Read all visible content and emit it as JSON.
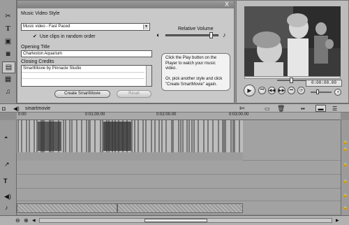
{
  "editor": {
    "close_label": "X",
    "music_video_style_label": "Music Video Style",
    "style_value": "Music video - Fast Paced",
    "random_order_label": "Use clips in random order",
    "relative_volume_label": "Relative Volume",
    "opening_title_label": "Opening Title",
    "opening_title_value": "Charleston Aquarium",
    "closing_credits_label": "Closing Credits",
    "closing_credits_value": "SmartMovie by Pinnacle Studio",
    "create_button": "Create SmartMovie",
    "reset_button": "Reset",
    "hint_text": "Click the Play button on the Player to watch your music video.\n\nOr, pick another style and click \"Create SmartMovie\" again."
  },
  "player": {
    "timecode": "0:00:00.00"
  },
  "timeline": {
    "project_name": "smartmovie",
    "ruler": [
      "0:00",
      "0:01:00.00",
      "0:02:00.00",
      "0:03:00.00"
    ]
  },
  "colors": {
    "panel": "#c9c9c9",
    "timeline_bg": "#8e8e8e"
  }
}
